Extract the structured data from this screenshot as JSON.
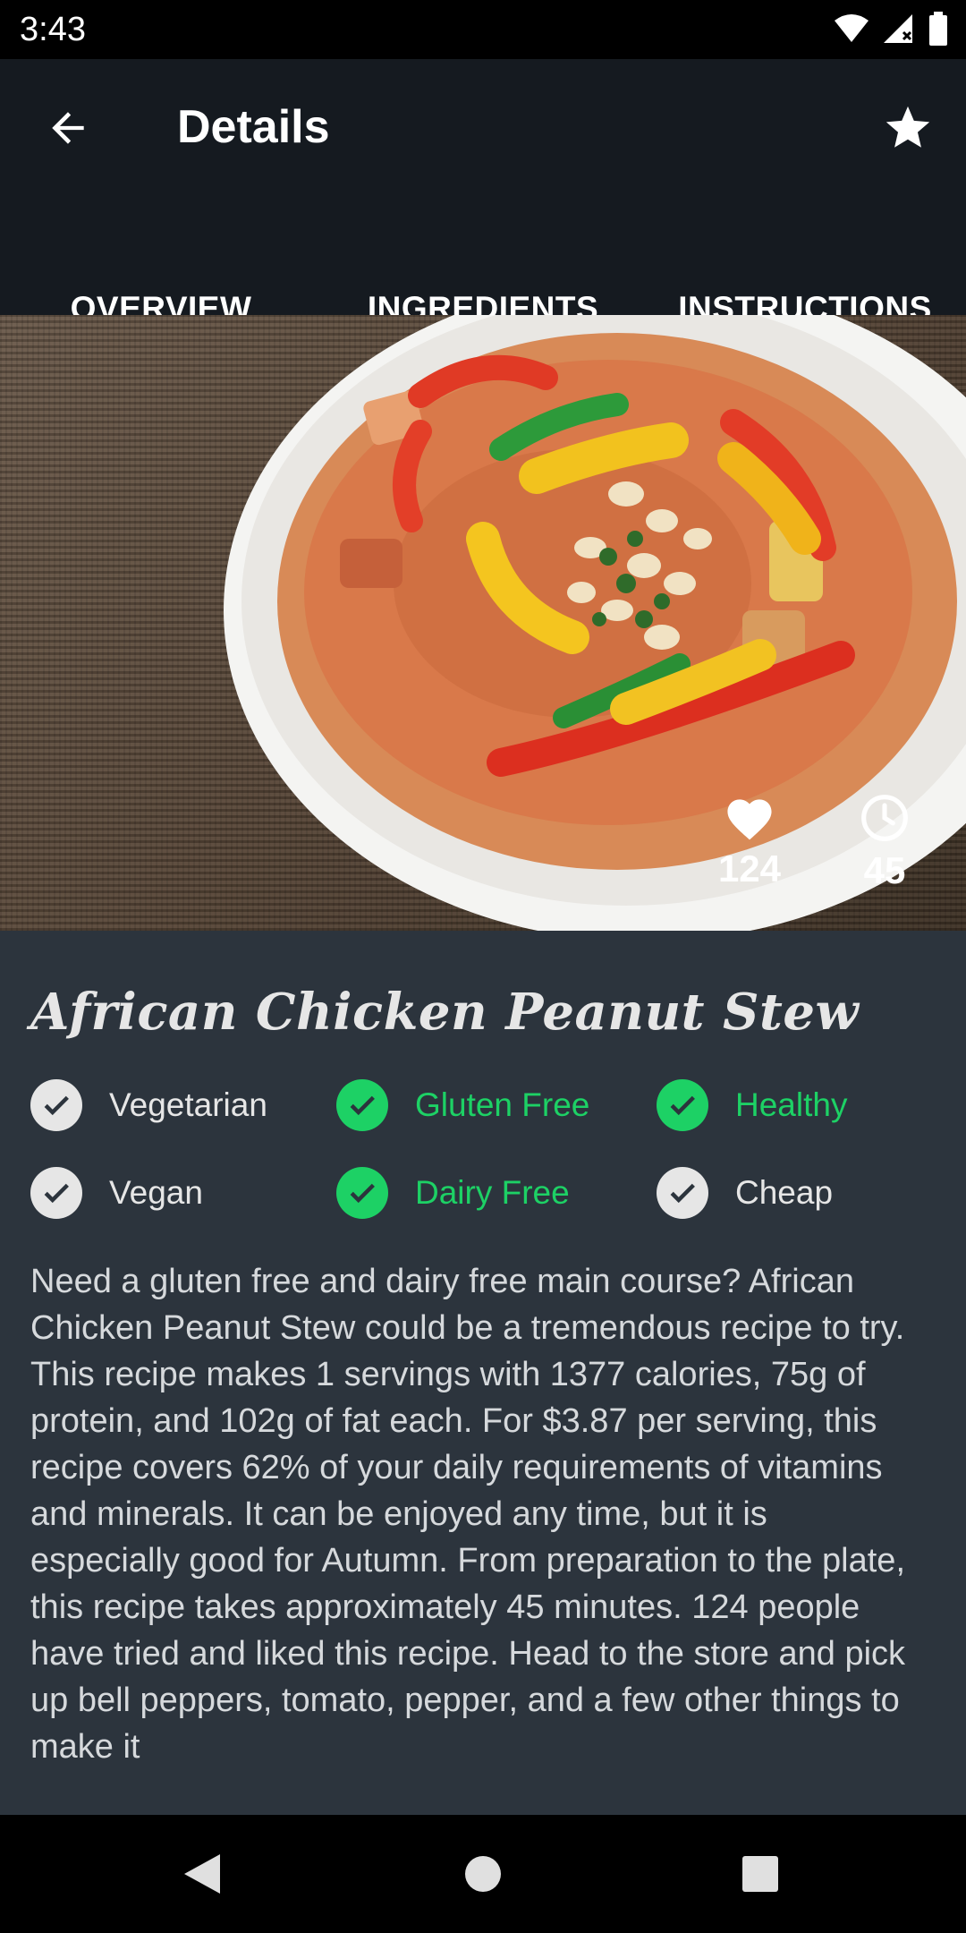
{
  "status_bar": {
    "time": "3:43",
    "icons": [
      "wifi-icon",
      "signal-icon",
      "battery-icon"
    ]
  },
  "app_bar": {
    "title": "Details",
    "back_icon": "arrow-back-icon",
    "favorite_icon": "star-icon"
  },
  "tabs": [
    {
      "label": "OVERVIEW",
      "active": true
    },
    {
      "label": "INGREDIENTS",
      "active": false
    },
    {
      "label": "INSTRUCTIONS",
      "active": false
    }
  ],
  "hero": {
    "likes": "124",
    "minutes": "45",
    "like_icon": "heart-icon",
    "time_icon": "clock-icon"
  },
  "recipe": {
    "title": "African Chicken Peanut Stew",
    "flags": [
      {
        "label": "Vegetarian",
        "active": false
      },
      {
        "label": "Gluten Free",
        "active": true
      },
      {
        "label": "Healthy",
        "active": true
      },
      {
        "label": "Vegan",
        "active": false
      },
      {
        "label": "Dairy Free",
        "active": true
      },
      {
        "label": "Cheap",
        "active": false
      }
    ],
    "summary": "Need a gluten free and dairy free main course? African Chicken Peanut Stew could be a tremendous recipe to try. This recipe makes 1 servings with 1377 calories, 75g of protein, and 102g of fat each. For $3.87 per serving, this recipe covers 62% of your daily requirements of vitamins and minerals. It can be enjoyed any time, but it is especially good for Autumn. From preparation to the plate, this recipe takes approximately 45 minutes. 124 people have tried and liked this recipe. Head to the store and pick up bell peppers, tomato, pepper, and a few other things to make it"
  },
  "colors": {
    "app_bar": "#151a20",
    "content_bg": "#2c343d",
    "accent_green": "#1dd165",
    "inactive": "#e6e6e6"
  },
  "nav_bar": {
    "icons": [
      "back-triangle-icon",
      "home-circle-icon",
      "recents-square-icon"
    ]
  }
}
